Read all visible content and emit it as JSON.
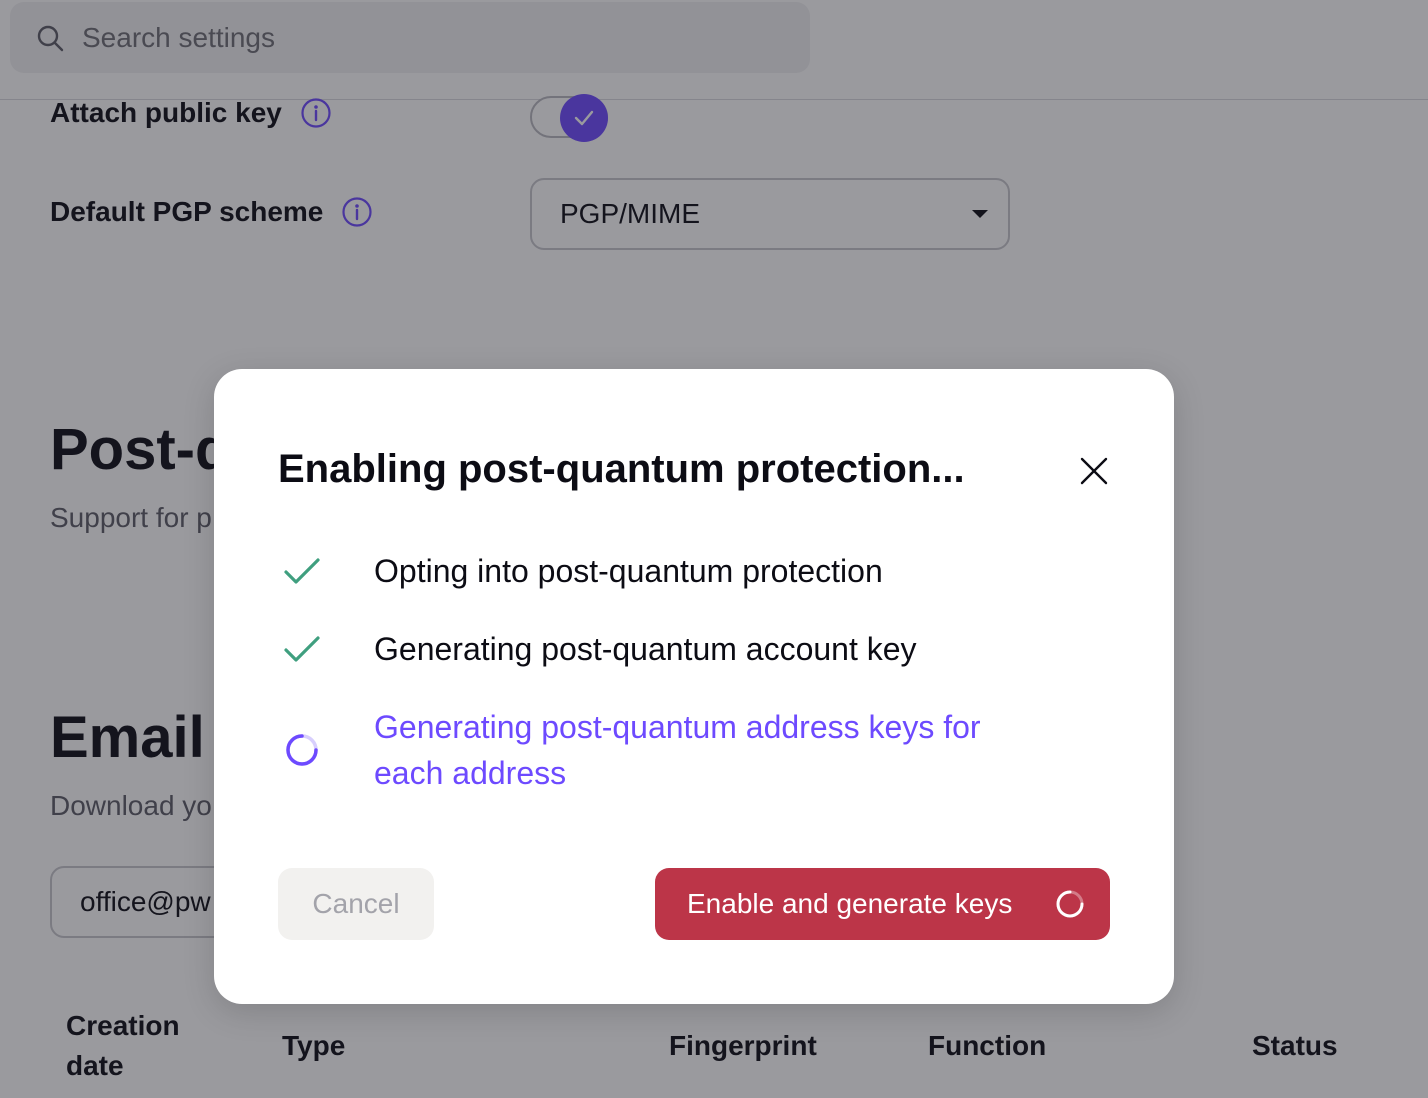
{
  "search": {
    "placeholder": "Search settings"
  },
  "settings": {
    "attach_public_key": {
      "label": "Attach public key",
      "enabled": true
    },
    "default_pgp_scheme": {
      "label": "Default PGP scheme",
      "value": "PGP/MIME"
    }
  },
  "sections": {
    "post_quantum": {
      "title_visible": "Post-q",
      "desc_visible": "Support for p"
    },
    "email_keys": {
      "title_visible": "Email e",
      "desc_visible": "Download yo",
      "address_visible": "office@pw"
    }
  },
  "table": {
    "columns": [
      "Creation date",
      "Type",
      "Fingerprint",
      "Function",
      "Status"
    ]
  },
  "modal": {
    "title": "Enabling post-quantum protection...",
    "steps": [
      {
        "label": "Opting into post-quantum protection",
        "state": "done"
      },
      {
        "label": "Generating post-quantum account key",
        "state": "done"
      },
      {
        "label": "Generating post-quantum address keys for each address",
        "state": "in-progress"
      }
    ],
    "cancel_label": "Cancel",
    "primary_label": "Enable and generate keys"
  },
  "colors": {
    "accent": "#6d4aff",
    "done_check": "#3f9f7f",
    "danger": "#bc3548",
    "overlay": "rgba(30,30,40,0.45)"
  },
  "icons": {
    "search": "search-icon",
    "info": "info-icon",
    "close": "close-icon",
    "check": "check-icon",
    "spinner": "spinner-icon",
    "caret": "caret-down-icon"
  }
}
